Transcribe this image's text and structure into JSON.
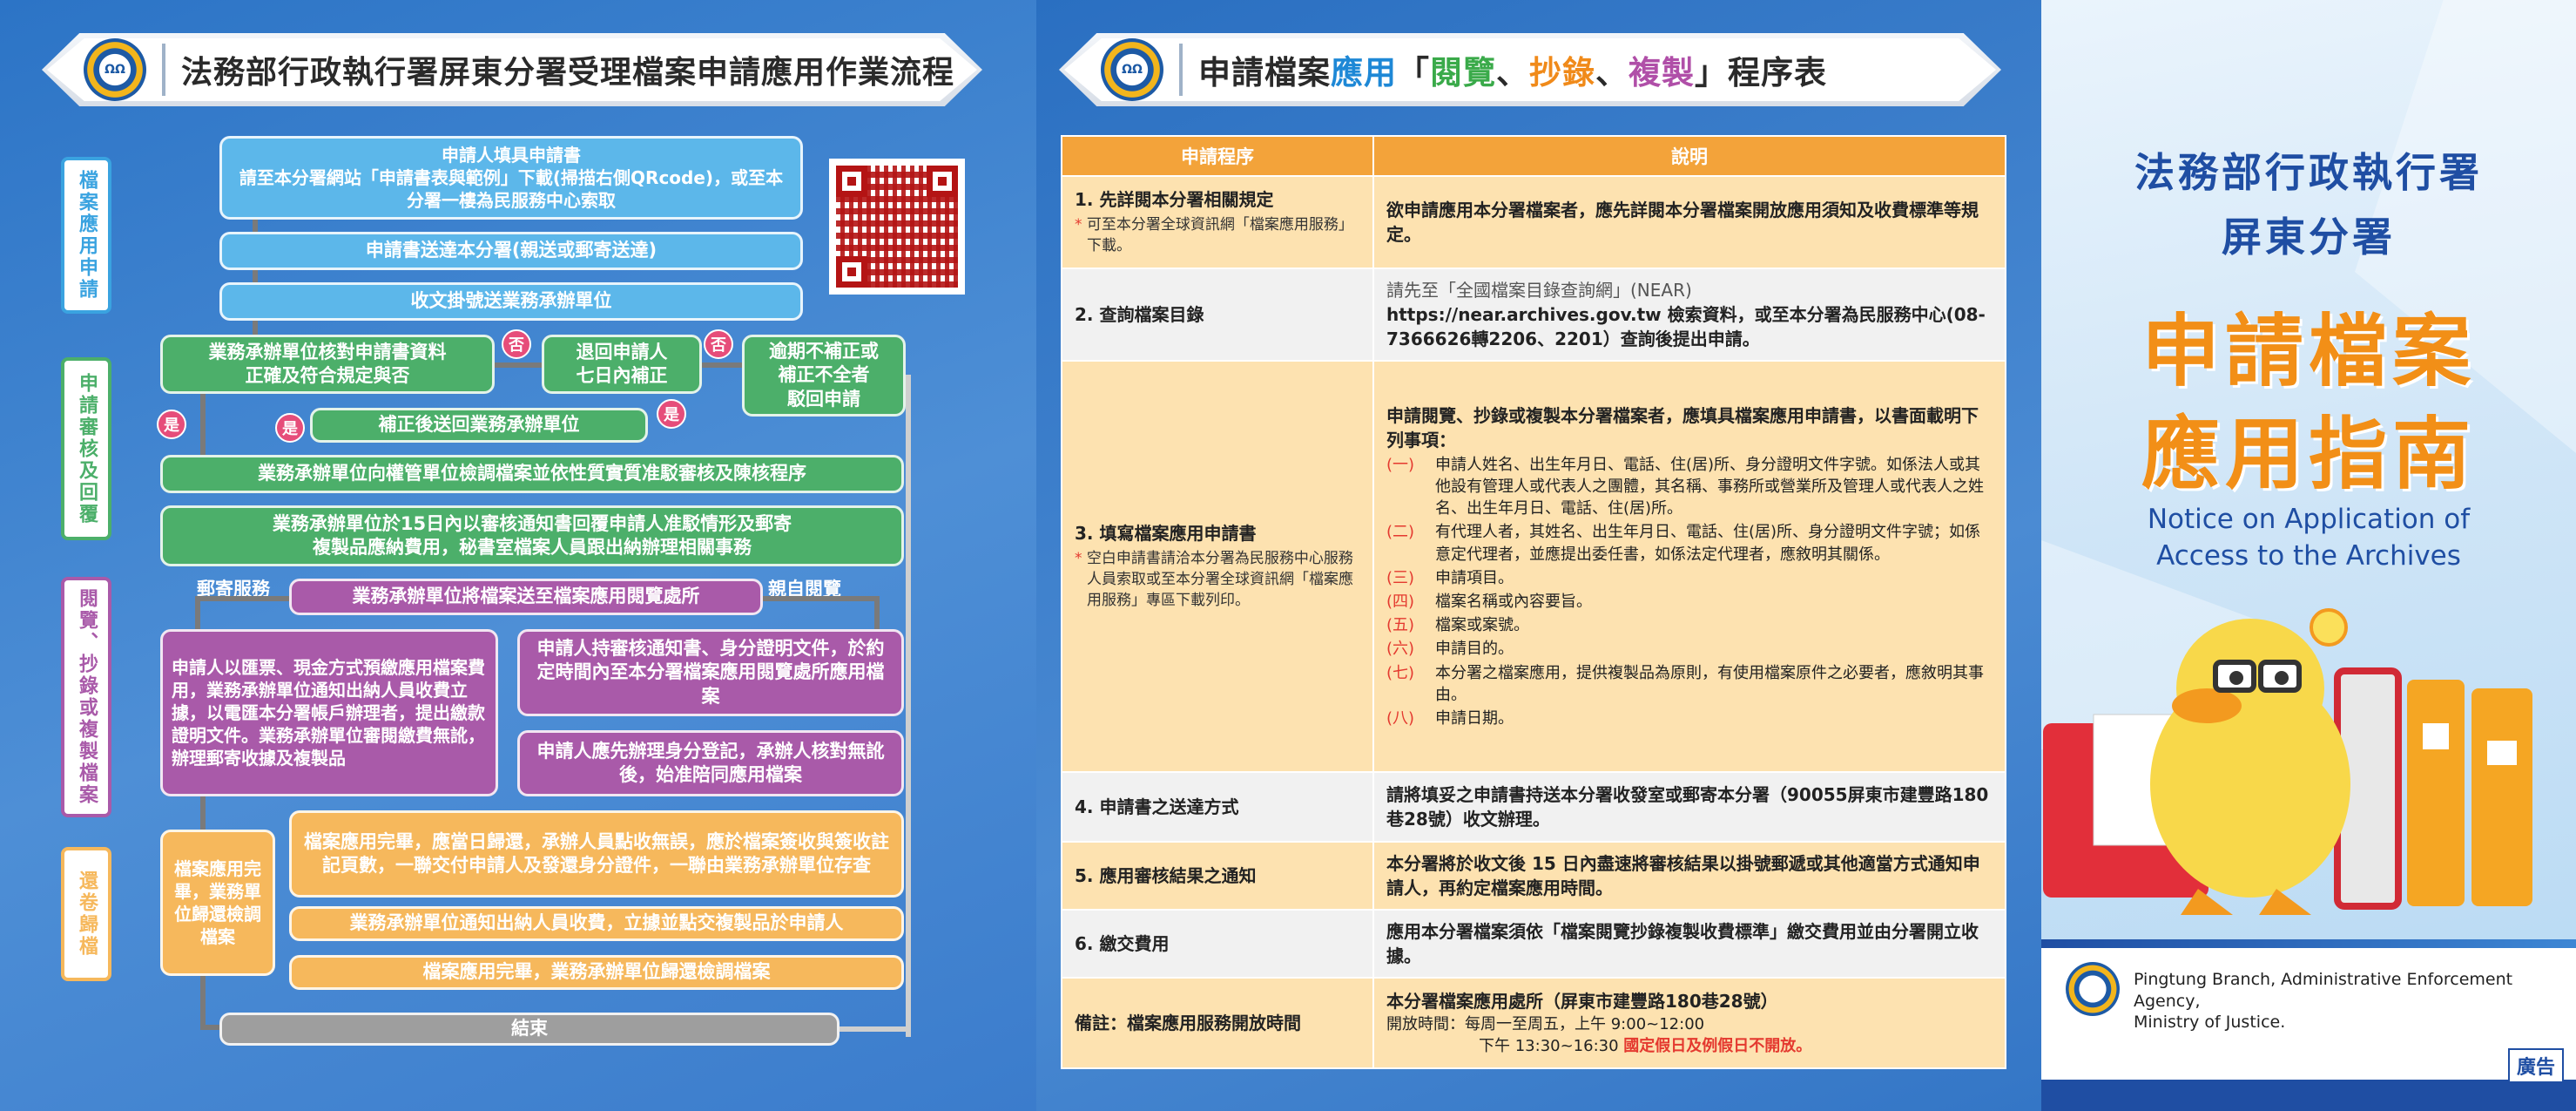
{
  "left": {
    "banner_title": "法務部行政執行署屏東分署受理檔案申請應用作業流程",
    "logo_text": "ΩΩ",
    "tabs": [
      {
        "label": "檔案應用申請",
        "color": "#3aa3e0"
      },
      {
        "label": "申請審核及回覆",
        "color": "#4caf6a"
      },
      {
        "label": "閱覽、抄錄或複製檔案",
        "color": "#a95aa9"
      },
      {
        "label": "還卷歸檔",
        "color": "#f6b85c"
      }
    ],
    "flow": {
      "s1": "申請人填具申請書\n請至本分署網站「申請書表與範例」下載(掃描右側QRcode)，或至本分署一樓為民服務中心索取",
      "s2": "申請書送達本分署(親送或郵寄送達)",
      "s3": "收文掛號送業務承辦單位",
      "s4": "業務承辦單位核對申請書資料\n正確及符合規定與否",
      "s5": "退回申請人\n七日內補正",
      "s6": "逾期不補正或\n補正不全者\n駁回申請",
      "s7": "補正後送回業務承辦單位",
      "s8": "業務承辦單位向權管單位檢調檔案並依性質實質准駁審核及陳核程序",
      "s9": "業務承辦單位於15日內以審核通知書回覆申請人准駁情形及郵寄\n複製品應納費用，秘書室檔案人員跟出納辦理相關事務",
      "s10": "業務承辦單位將檔案送至檔案應用閱覽處所",
      "mail_label": "郵寄服務",
      "self_label": "親自閱覽",
      "s11": "申請人以匯票、現金方式預繳應用檔案費用，業務承辦單位通知出納人員收費立據，以電匯本分署帳戶辦理者，提出繳款證明文件。業務承辦單位審閱繳費無訛，辦理郵寄收據及複製品",
      "s12": "申請人持審核通知書、身分證明文件，於約定時間內至本分署檔案應用閱覽處所應用檔案",
      "s13": "申請人應先辦理身分登記，承辦人核對無訛後，始准陪同應用檔案",
      "s14": "檔案應用完畢，應當日歸還，承辦人員點收無誤，應於檔案簽收與簽收註記頁數，一聯交付申請人及發還身分證件，一聯由業務承辦單位存查",
      "s15": "檔案應用完畢，業務單位歸還檢調檔案",
      "s16": "業務承辦單位通知出納人員收費，立據並點交複製品於申請人",
      "s17": "檔案應用完畢，業務承辦單位歸還檢調檔案",
      "s18": "結束",
      "no": "否",
      "yes": "是"
    }
  },
  "middle": {
    "banner_title_parts": [
      "申請檔案",
      "應用",
      "「",
      "閱覽",
      "、",
      "抄錄",
      "、",
      "複製",
      "」程序表"
    ],
    "header": {
      "col1": "申請程序",
      "col2": "說明"
    },
    "rows": [
      {
        "step": "1. 先詳閱本分署相關規定",
        "note": "可至本分署全球資訊網「檔案應用服務」下載。",
        "desc": "欲申請應用本分署檔案者，應先詳閱本分署檔案開放應用須知及收費標準等規定。"
      },
      {
        "step": "2. 查詢檔案目錄",
        "desc_gray": "請先至「全國檔案目錄查詢網」(NEAR)",
        "desc": "https://near.archives.gov.tw 檢索資料，或至本分署為民服務中心(08-7366626轉2206、2201）查詢後提出申請。"
      },
      {
        "step": "3. 填寫檔案應用申請書",
        "note": "空白申請書請洽本分署為民服務中心服務人員索取或至本分署全球資訊網「檔案應用服務」專區下載列印。",
        "desc": "申請閱覽、抄錄或複製本分署檔案者，應填具檔案應用申請書，以書面載明下列事項：",
        "items": [
          {
            "num": "(一)",
            "text": "申請人姓名、出生年月日、電話、住(居)所、身分證明文件字號。如係法人或其他設有管理人或代表人之團體，其名稱、事務所或營業所及管理人或代表人之姓名、出生年月日、電話、住(居)所。"
          },
          {
            "num": "(二)",
            "text": "有代理人者，其姓名、出生年月日、電話、住(居)所、身分證明文件字號；如係意定代理者，並應提出委任書，如係法定代理者，應敘明其關係。"
          },
          {
            "num": "(三)",
            "text": "申請項目。"
          },
          {
            "num": "(四)",
            "text": "檔案名稱或內容要旨。"
          },
          {
            "num": "(五)",
            "text": "檔案或案號。"
          },
          {
            "num": "(六)",
            "text": "申請目的。"
          },
          {
            "num": "(七)",
            "text": "本分署之檔案應用，提供複製品為原則，有使用檔案原件之必要者，應敘明其事由。"
          },
          {
            "num": "(八)",
            "text": "申請日期。"
          }
        ]
      },
      {
        "step": "4. 申請書之送達方式",
        "desc": "請將填妥之申請書持送本分署收發室或郵寄本分署（90055屏東市建豐路180巷28號）收文辦理。"
      },
      {
        "step": "5. 應用審核結果之通知",
        "desc": "本分署將於收文後 15 日內盡速將審核結果以掛號郵遞或其他適當方式通知申請人，再約定檔案應用時間。"
      },
      {
        "step": "6. 繳交費用",
        "desc": "應用本分署檔案須依「檔案閱覽抄錄複製收費標準」繳交費用並由分署開立收據。"
      },
      {
        "step": "備註：檔案應用服務開放時間",
        "desc": "本分署檔案應用處所（屏東市建豐路180巷28號）",
        "hours1": "開放時間：每周一至周五，上午 9:00~12:00",
        "hours2": "下午 13:30~16:30",
        "hours_red": "國定假日及例假日不開放。"
      }
    ]
  },
  "right": {
    "org_line1": "法務部行政執行署",
    "org_line2": "屏東分署",
    "title_line1": "申請檔案",
    "title_line2": "應用指南",
    "en_line1": "Notice on Application of",
    "en_line2": "Access to the Archives",
    "footer_en1": "Pingtung Branch, Administrative Enforcement Agency,",
    "footer_en2": "Ministry of Justice.",
    "ad": "廣告"
  }
}
